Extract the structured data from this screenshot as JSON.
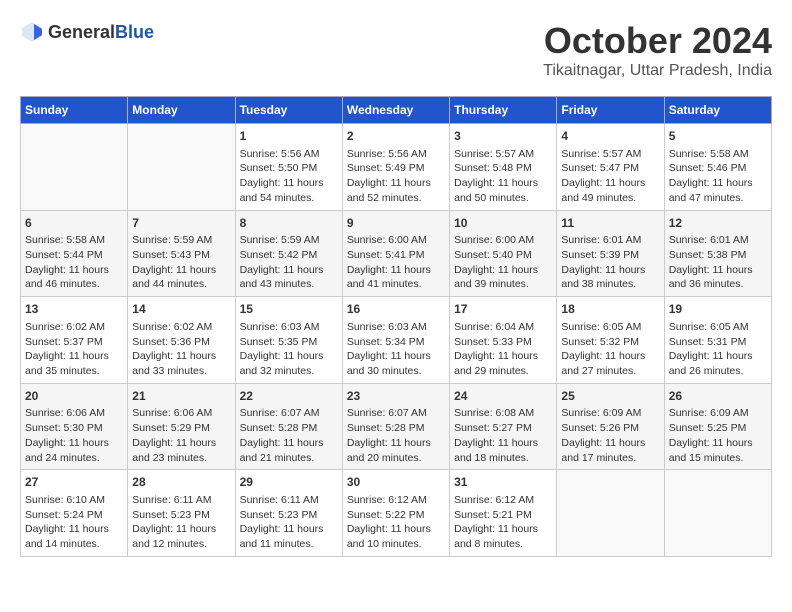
{
  "header": {
    "logo_general": "General",
    "logo_blue": "Blue",
    "month": "October 2024",
    "location": "Tikaitnagar, Uttar Pradesh, India"
  },
  "weekdays": [
    "Sunday",
    "Monday",
    "Tuesday",
    "Wednesday",
    "Thursday",
    "Friday",
    "Saturday"
  ],
  "weeks": [
    [
      {
        "day": "",
        "info": ""
      },
      {
        "day": "",
        "info": ""
      },
      {
        "day": "1",
        "info": "Sunrise: 5:56 AM\nSunset: 5:50 PM\nDaylight: 11 hours and 54 minutes."
      },
      {
        "day": "2",
        "info": "Sunrise: 5:56 AM\nSunset: 5:49 PM\nDaylight: 11 hours and 52 minutes."
      },
      {
        "day": "3",
        "info": "Sunrise: 5:57 AM\nSunset: 5:48 PM\nDaylight: 11 hours and 50 minutes."
      },
      {
        "day": "4",
        "info": "Sunrise: 5:57 AM\nSunset: 5:47 PM\nDaylight: 11 hours and 49 minutes."
      },
      {
        "day": "5",
        "info": "Sunrise: 5:58 AM\nSunset: 5:46 PM\nDaylight: 11 hours and 47 minutes."
      }
    ],
    [
      {
        "day": "6",
        "info": "Sunrise: 5:58 AM\nSunset: 5:44 PM\nDaylight: 11 hours and 46 minutes."
      },
      {
        "day": "7",
        "info": "Sunrise: 5:59 AM\nSunset: 5:43 PM\nDaylight: 11 hours and 44 minutes."
      },
      {
        "day": "8",
        "info": "Sunrise: 5:59 AM\nSunset: 5:42 PM\nDaylight: 11 hours and 43 minutes."
      },
      {
        "day": "9",
        "info": "Sunrise: 6:00 AM\nSunset: 5:41 PM\nDaylight: 11 hours and 41 minutes."
      },
      {
        "day": "10",
        "info": "Sunrise: 6:00 AM\nSunset: 5:40 PM\nDaylight: 11 hours and 39 minutes."
      },
      {
        "day": "11",
        "info": "Sunrise: 6:01 AM\nSunset: 5:39 PM\nDaylight: 11 hours and 38 minutes."
      },
      {
        "day": "12",
        "info": "Sunrise: 6:01 AM\nSunset: 5:38 PM\nDaylight: 11 hours and 36 minutes."
      }
    ],
    [
      {
        "day": "13",
        "info": "Sunrise: 6:02 AM\nSunset: 5:37 PM\nDaylight: 11 hours and 35 minutes."
      },
      {
        "day": "14",
        "info": "Sunrise: 6:02 AM\nSunset: 5:36 PM\nDaylight: 11 hours and 33 minutes."
      },
      {
        "day": "15",
        "info": "Sunrise: 6:03 AM\nSunset: 5:35 PM\nDaylight: 11 hours and 32 minutes."
      },
      {
        "day": "16",
        "info": "Sunrise: 6:03 AM\nSunset: 5:34 PM\nDaylight: 11 hours and 30 minutes."
      },
      {
        "day": "17",
        "info": "Sunrise: 6:04 AM\nSunset: 5:33 PM\nDaylight: 11 hours and 29 minutes."
      },
      {
        "day": "18",
        "info": "Sunrise: 6:05 AM\nSunset: 5:32 PM\nDaylight: 11 hours and 27 minutes."
      },
      {
        "day": "19",
        "info": "Sunrise: 6:05 AM\nSunset: 5:31 PM\nDaylight: 11 hours and 26 minutes."
      }
    ],
    [
      {
        "day": "20",
        "info": "Sunrise: 6:06 AM\nSunset: 5:30 PM\nDaylight: 11 hours and 24 minutes."
      },
      {
        "day": "21",
        "info": "Sunrise: 6:06 AM\nSunset: 5:29 PM\nDaylight: 11 hours and 23 minutes."
      },
      {
        "day": "22",
        "info": "Sunrise: 6:07 AM\nSunset: 5:28 PM\nDaylight: 11 hours and 21 minutes."
      },
      {
        "day": "23",
        "info": "Sunrise: 6:07 AM\nSunset: 5:28 PM\nDaylight: 11 hours and 20 minutes."
      },
      {
        "day": "24",
        "info": "Sunrise: 6:08 AM\nSunset: 5:27 PM\nDaylight: 11 hours and 18 minutes."
      },
      {
        "day": "25",
        "info": "Sunrise: 6:09 AM\nSunset: 5:26 PM\nDaylight: 11 hours and 17 minutes."
      },
      {
        "day": "26",
        "info": "Sunrise: 6:09 AM\nSunset: 5:25 PM\nDaylight: 11 hours and 15 minutes."
      }
    ],
    [
      {
        "day": "27",
        "info": "Sunrise: 6:10 AM\nSunset: 5:24 PM\nDaylight: 11 hours and 14 minutes."
      },
      {
        "day": "28",
        "info": "Sunrise: 6:11 AM\nSunset: 5:23 PM\nDaylight: 11 hours and 12 minutes."
      },
      {
        "day": "29",
        "info": "Sunrise: 6:11 AM\nSunset: 5:23 PM\nDaylight: 11 hours and 11 minutes."
      },
      {
        "day": "30",
        "info": "Sunrise: 6:12 AM\nSunset: 5:22 PM\nDaylight: 11 hours and 10 minutes."
      },
      {
        "day": "31",
        "info": "Sunrise: 6:12 AM\nSunset: 5:21 PM\nDaylight: 11 hours and 8 minutes."
      },
      {
        "day": "",
        "info": ""
      },
      {
        "day": "",
        "info": ""
      }
    ]
  ]
}
